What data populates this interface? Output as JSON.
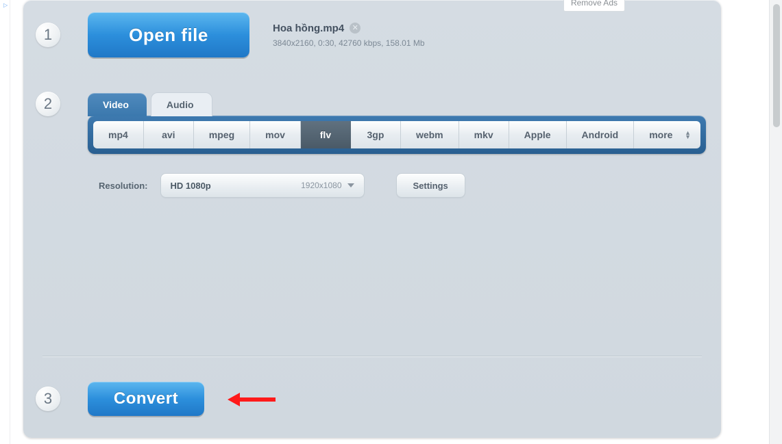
{
  "top": {
    "remove_ads": "Remove Ads"
  },
  "steps": {
    "one": "1",
    "two": "2",
    "three": "3"
  },
  "open_file_label": "Open file",
  "file": {
    "name": "Hoa hồng.mp4",
    "meta": "3840x2160, 0:30, 42760 kbps, 158.01 Mb"
  },
  "tabs": {
    "video": "Video",
    "audio": "Audio",
    "active": "video"
  },
  "formats": {
    "items": [
      "mp4",
      "avi",
      "mpeg",
      "mov",
      "flv",
      "3gp",
      "webm",
      "mkv",
      "Apple",
      "Android"
    ],
    "more_label": "more",
    "selected": "flv"
  },
  "resolution": {
    "label": "Resolution:",
    "name": "HD 1080p",
    "dim": "1920x1080"
  },
  "settings_label": "Settings",
  "convert_label": "Convert"
}
